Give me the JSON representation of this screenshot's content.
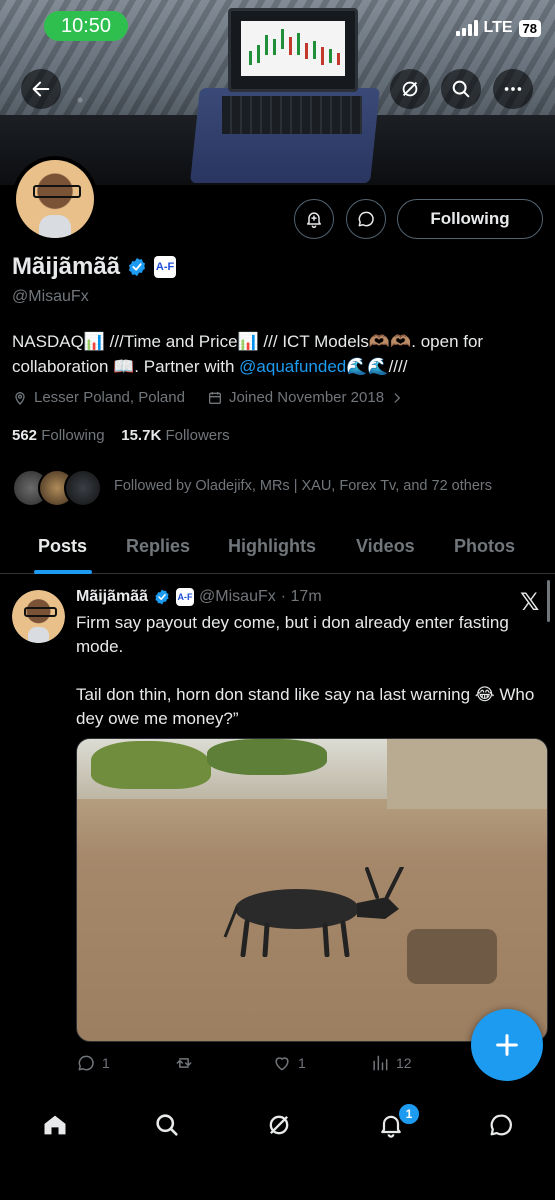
{
  "status_bar": {
    "time": "10:50",
    "network": "LTE",
    "battery": "78"
  },
  "profile": {
    "display_name": "Mãijãmãã",
    "affiliation_badge": "A-F",
    "handle": "@MisauFx",
    "bio_part1": "NASDAQ📊 ///Time and Price📊 /// ICT Models🫶🏽🫶🏽. open for collaboration 📖. Partner with ",
    "bio_mention": "@aquafunded",
    "bio_part2": "🌊🌊////",
    "location": "Lesser Poland, Poland",
    "joined": "Joined November 2018",
    "following_count": "562",
    "following_label": "Following",
    "followers_count": "15.7K",
    "followers_label": "Followers",
    "follow_button": "Following",
    "followed_by": "Followed by Oladejifx, MRs | XAU, Forex Tv, and 72 others"
  },
  "tabs": [
    {
      "label": "Posts",
      "active": true
    },
    {
      "label": "Replies",
      "active": false
    },
    {
      "label": "Highlights",
      "active": false
    },
    {
      "label": "Videos",
      "active": false
    },
    {
      "label": "Photos",
      "active": false
    }
  ],
  "post": {
    "name": "Mãijãmãã",
    "badge": "A-F",
    "handle": "@MisauFx",
    "time": "· 17m",
    "text": "Firm say payout dey come, but i don already enter fasting mode.\n\nTail don thin, horn don stand like say na last warning 😂 Who dey owe me money?”",
    "replies": "1",
    "likes": "1",
    "views": "12"
  },
  "nav": {
    "notifications_badge": "1"
  },
  "colors": {
    "accent": "#1d9bf0",
    "status_green": "#2fbf4f",
    "muted": "#71767b"
  }
}
